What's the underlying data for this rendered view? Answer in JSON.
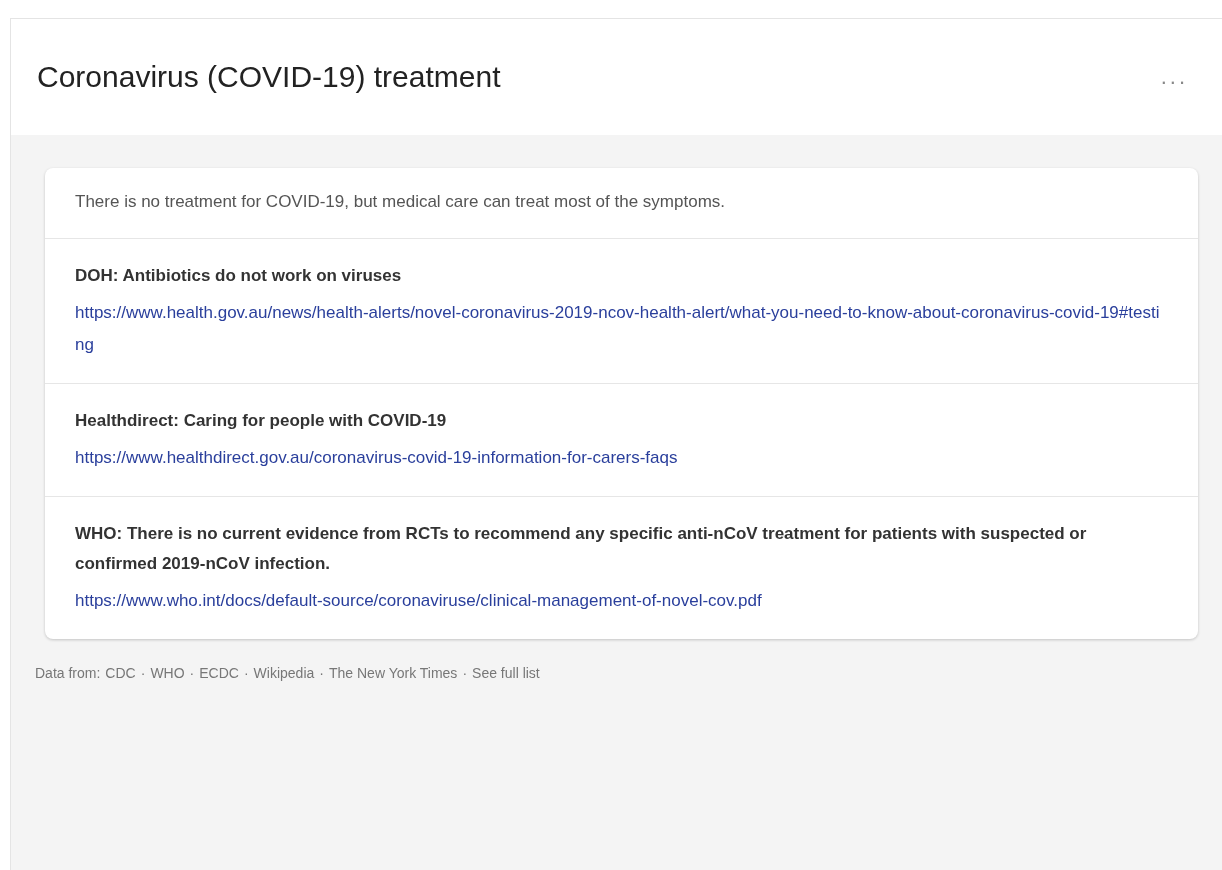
{
  "card": {
    "title": "Coronavirus (COVID-19) treatment",
    "menu_icon": "..."
  },
  "summary": "There is no treatment for COVID-19, but medical care can treat most of the symptoms.",
  "sources": [
    {
      "heading": "DOH: Antibiotics do not work on viruses",
      "url": "https://www.health.gov.au/news/health-alerts/novel-coronavirus-2019-ncov-health-alert/what-you-need-to-know-about-coronavirus-covid-19#testing"
    },
    {
      "heading": "Healthdirect: Caring for people with COVID-19",
      "url": "https://www.healthdirect.gov.au/coronavirus-covid-19-information-for-carers-faqs"
    },
    {
      "heading": "WHO: There is no current evidence from RCTs to recommend any specific anti-nCoV treatment for patients with suspected or confirmed 2019-nCoV infection.",
      "url": "https://www.who.int/docs/default-source/coronaviruse/clinical-management-of-novel-cov.pdf"
    }
  ],
  "footer": {
    "label": "Data from:",
    "separator": "·",
    "links": [
      "CDC",
      "WHO",
      "ECDC",
      "Wikipedia",
      "The New York Times",
      "See full list"
    ]
  }
}
